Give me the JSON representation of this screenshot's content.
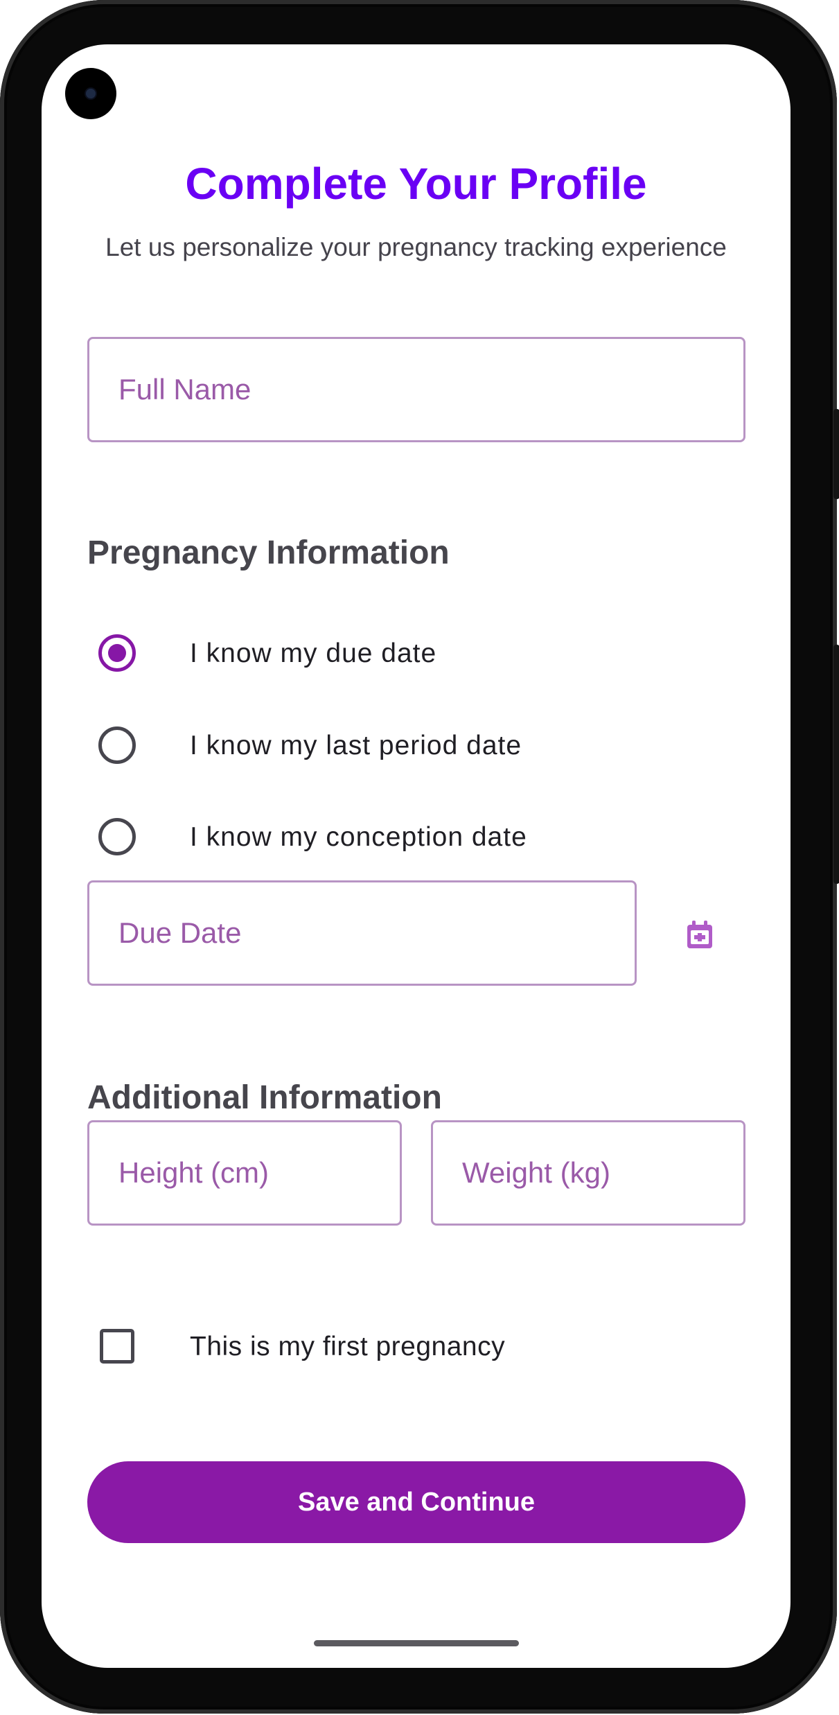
{
  "header": {
    "title": "Complete Your Profile",
    "subtitle": "Let us personalize your pregnancy tracking experience"
  },
  "form": {
    "full_name": {
      "placeholder": "Full Name",
      "value": ""
    },
    "pregnancy_section_title": "Pregnancy Information",
    "date_options": [
      {
        "label": "I know my due date",
        "selected": true
      },
      {
        "label": "I know my last period date",
        "selected": false
      },
      {
        "label": "I know my conception date",
        "selected": false
      }
    ],
    "due_date": {
      "placeholder": "Due Date",
      "value": "",
      "icon": "calendar-icon"
    },
    "additional_section_title": "Additional Information",
    "height": {
      "placeholder": "Height (cm)",
      "value": ""
    },
    "weight": {
      "placeholder": "Weight (kg)",
      "value": ""
    },
    "first_pregnancy": {
      "label": "This is my first pregnancy",
      "checked": false
    },
    "submit_label": "Save and Continue"
  },
  "colors": {
    "title": "#6a00f4",
    "accent": "#8a19a6",
    "field_border": "#b894c4",
    "placeholder": "#9a5aa8"
  }
}
